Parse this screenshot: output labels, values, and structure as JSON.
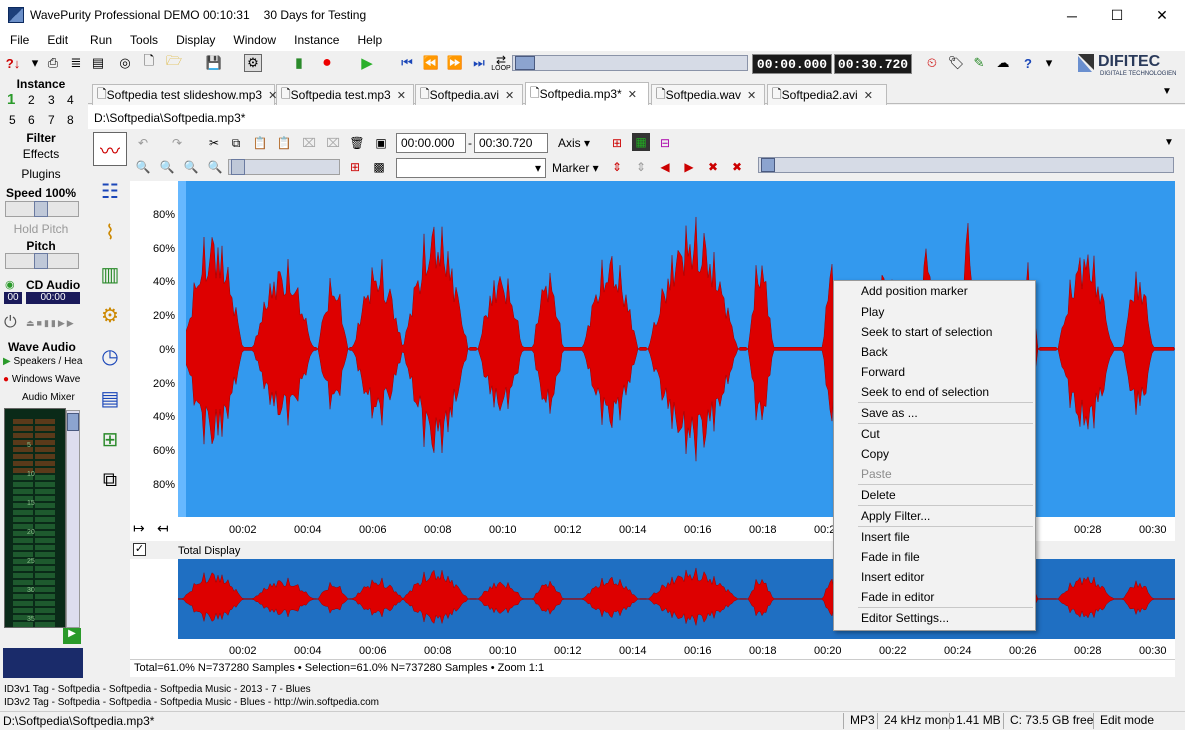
{
  "window": {
    "title": "WavePurity Professional DEMO 00:10:31",
    "subtitle": "30 Days for Testing",
    "minimize": "─",
    "maximize": "☐",
    "close": "✕"
  },
  "menu": [
    "File",
    "Edit",
    "Run",
    "Tools",
    "Display",
    "Window",
    "Instance",
    "Help"
  ],
  "toolbar": {
    "time_start": "00:00.000",
    "time_end": "00:30.720",
    "loop_label": "LOOP"
  },
  "logo": {
    "text": "DIFITEC",
    "sub": "DIGITALE TECHNOLOGIEN"
  },
  "left": {
    "instance_label": "Instance",
    "instances": [
      "1",
      "2",
      "3",
      "4",
      "5",
      "6",
      "7",
      "8"
    ],
    "filter": "Filter",
    "effects": "Effects",
    "plugins": "Plugins",
    "speed": "Speed 100%",
    "hold_pitch": "Hold Pitch",
    "pitch": "Pitch",
    "cd_audio": "CD Audio",
    "cd_time1": "00",
    "cd_time2": "00:00",
    "wave_audio": "Wave Audio",
    "speakers": "Speakers / Hea",
    "windows_wave": "Windows Wave",
    "audio_mixer": "Audio Mixer",
    "meter_scale": [
      "5",
      "10",
      "15",
      "20",
      "25",
      "30",
      "35"
    ]
  },
  "tabs": [
    {
      "label": "Softpedia test slideshow.mp3"
    },
    {
      "label": "Softpedia test.mp3"
    },
    {
      "label": "Softpedia.avi"
    },
    {
      "label": "Softpedia.mp3*"
    },
    {
      "label": "Softpedia.wav"
    },
    {
      "label": "Softpedia2.avi"
    }
  ],
  "path": "D:\\Softpedia\\Softpedia.mp3*",
  "editor": {
    "sel_start": "00:00.000",
    "sel_end": "00:30.720",
    "axis_label": "Axis",
    "marker_label": "Marker",
    "separator": "-"
  },
  "y_labels": [
    "80%",
    "60%",
    "40%",
    "20%",
    "0%",
    "20%",
    "40%",
    "60%",
    "80%"
  ],
  "x_labels": [
    "00:02",
    "00:04",
    "00:06",
    "00:08",
    "00:10",
    "00:12",
    "00:14",
    "00:16",
    "00:18",
    "00:20",
    "00:22",
    "00:24",
    "00:26",
    "00:28",
    "00:30"
  ],
  "total_display": "Total Display",
  "status_line": "Total=61.0% N=737280 Samples • Selection=61.0% N=737280 Samples • Zoom 1:1",
  "id3": [
    "ID3v1 Tag - Softpedia - Softpedia - Softpedia Music - 2013 - 7 - Blues",
    "ID3v2 Tag - Softpedia - Softpedia - Softpedia Music - Blues - http://win.softpedia.com"
  ],
  "statusbar": {
    "path": "D:\\Softpedia\\Softpedia.mp3*",
    "format": "MP3",
    "rate": "24 kHz mono",
    "size": "1.41 MB",
    "free": "C: 73.5 GB free",
    "mode": "Edit mode"
  },
  "context_menu": [
    {
      "label": "Add position marker",
      "enabled": true
    },
    {
      "label": "Play",
      "enabled": true
    },
    {
      "label": "Seek to start of selection",
      "enabled": true
    },
    {
      "label": "Back",
      "enabled": true
    },
    {
      "label": "Forward",
      "enabled": true
    },
    {
      "label": "Seek to end of selection",
      "enabled": true
    },
    {
      "label": "Save as ...",
      "enabled": true
    },
    {
      "label": "Cut",
      "enabled": true
    },
    {
      "label": "Copy",
      "enabled": true
    },
    {
      "label": "Paste",
      "enabled": false
    },
    {
      "label": "Delete",
      "enabled": true
    },
    {
      "label": "Apply Filter...",
      "enabled": true
    },
    {
      "label": "Insert file",
      "enabled": true
    },
    {
      "label": "Fade in file",
      "enabled": true
    },
    {
      "label": "Insert editor",
      "enabled": true
    },
    {
      "label": "Fade in editor",
      "enabled": true
    },
    {
      "label": "Editor Settings...",
      "enabled": true
    }
  ],
  "colors": {
    "wave_bg": "#3399ee",
    "wave": "#dd0000",
    "overview_bg": "#1f6fc2"
  }
}
